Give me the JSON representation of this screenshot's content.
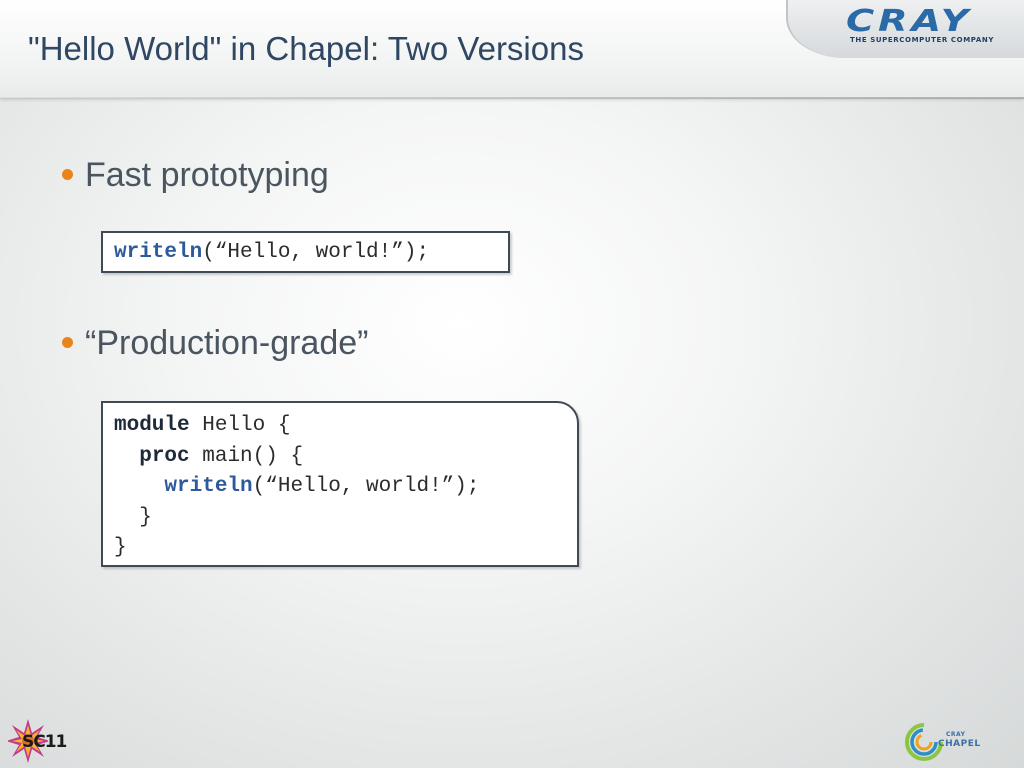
{
  "header": {
    "title": "\"Hello World\" in Chapel: Two Versions",
    "logo_word": "CRAY",
    "logo_tagline": "THE SUPERCOMPUTER COMPANY"
  },
  "bullets": [
    {
      "text": "Fast prototyping"
    },
    {
      "text": "“Production-grade”"
    }
  ],
  "code_simple": {
    "fn": "writeln",
    "rest": "(“Hello, world!”);"
  },
  "code_full": {
    "line1_kw": "module",
    "line1_rest": " Hello {",
    "line2_indent": "  ",
    "line2_kw": "proc",
    "line2_rest": " main() {",
    "line3_indent": "    ",
    "line3_fn": "writeln",
    "line3_rest": "(“Hello, world!”);",
    "line4": "  }",
    "line5": "}"
  },
  "footer": {
    "left_logo": "SC11",
    "right_logo_top": "CRAY",
    "right_logo_bottom": "CHAPEL"
  },
  "colors": {
    "title": "#2f4763",
    "bullet_dot": "#e8841e",
    "keyword_fn": "#2d5a9b",
    "cray_blue": "#2a6aa6"
  },
  "icons": [
    "bullet-dot-icon",
    "sc11-logo-icon",
    "chapel-logo-icon",
    "cray-logo-icon"
  ]
}
